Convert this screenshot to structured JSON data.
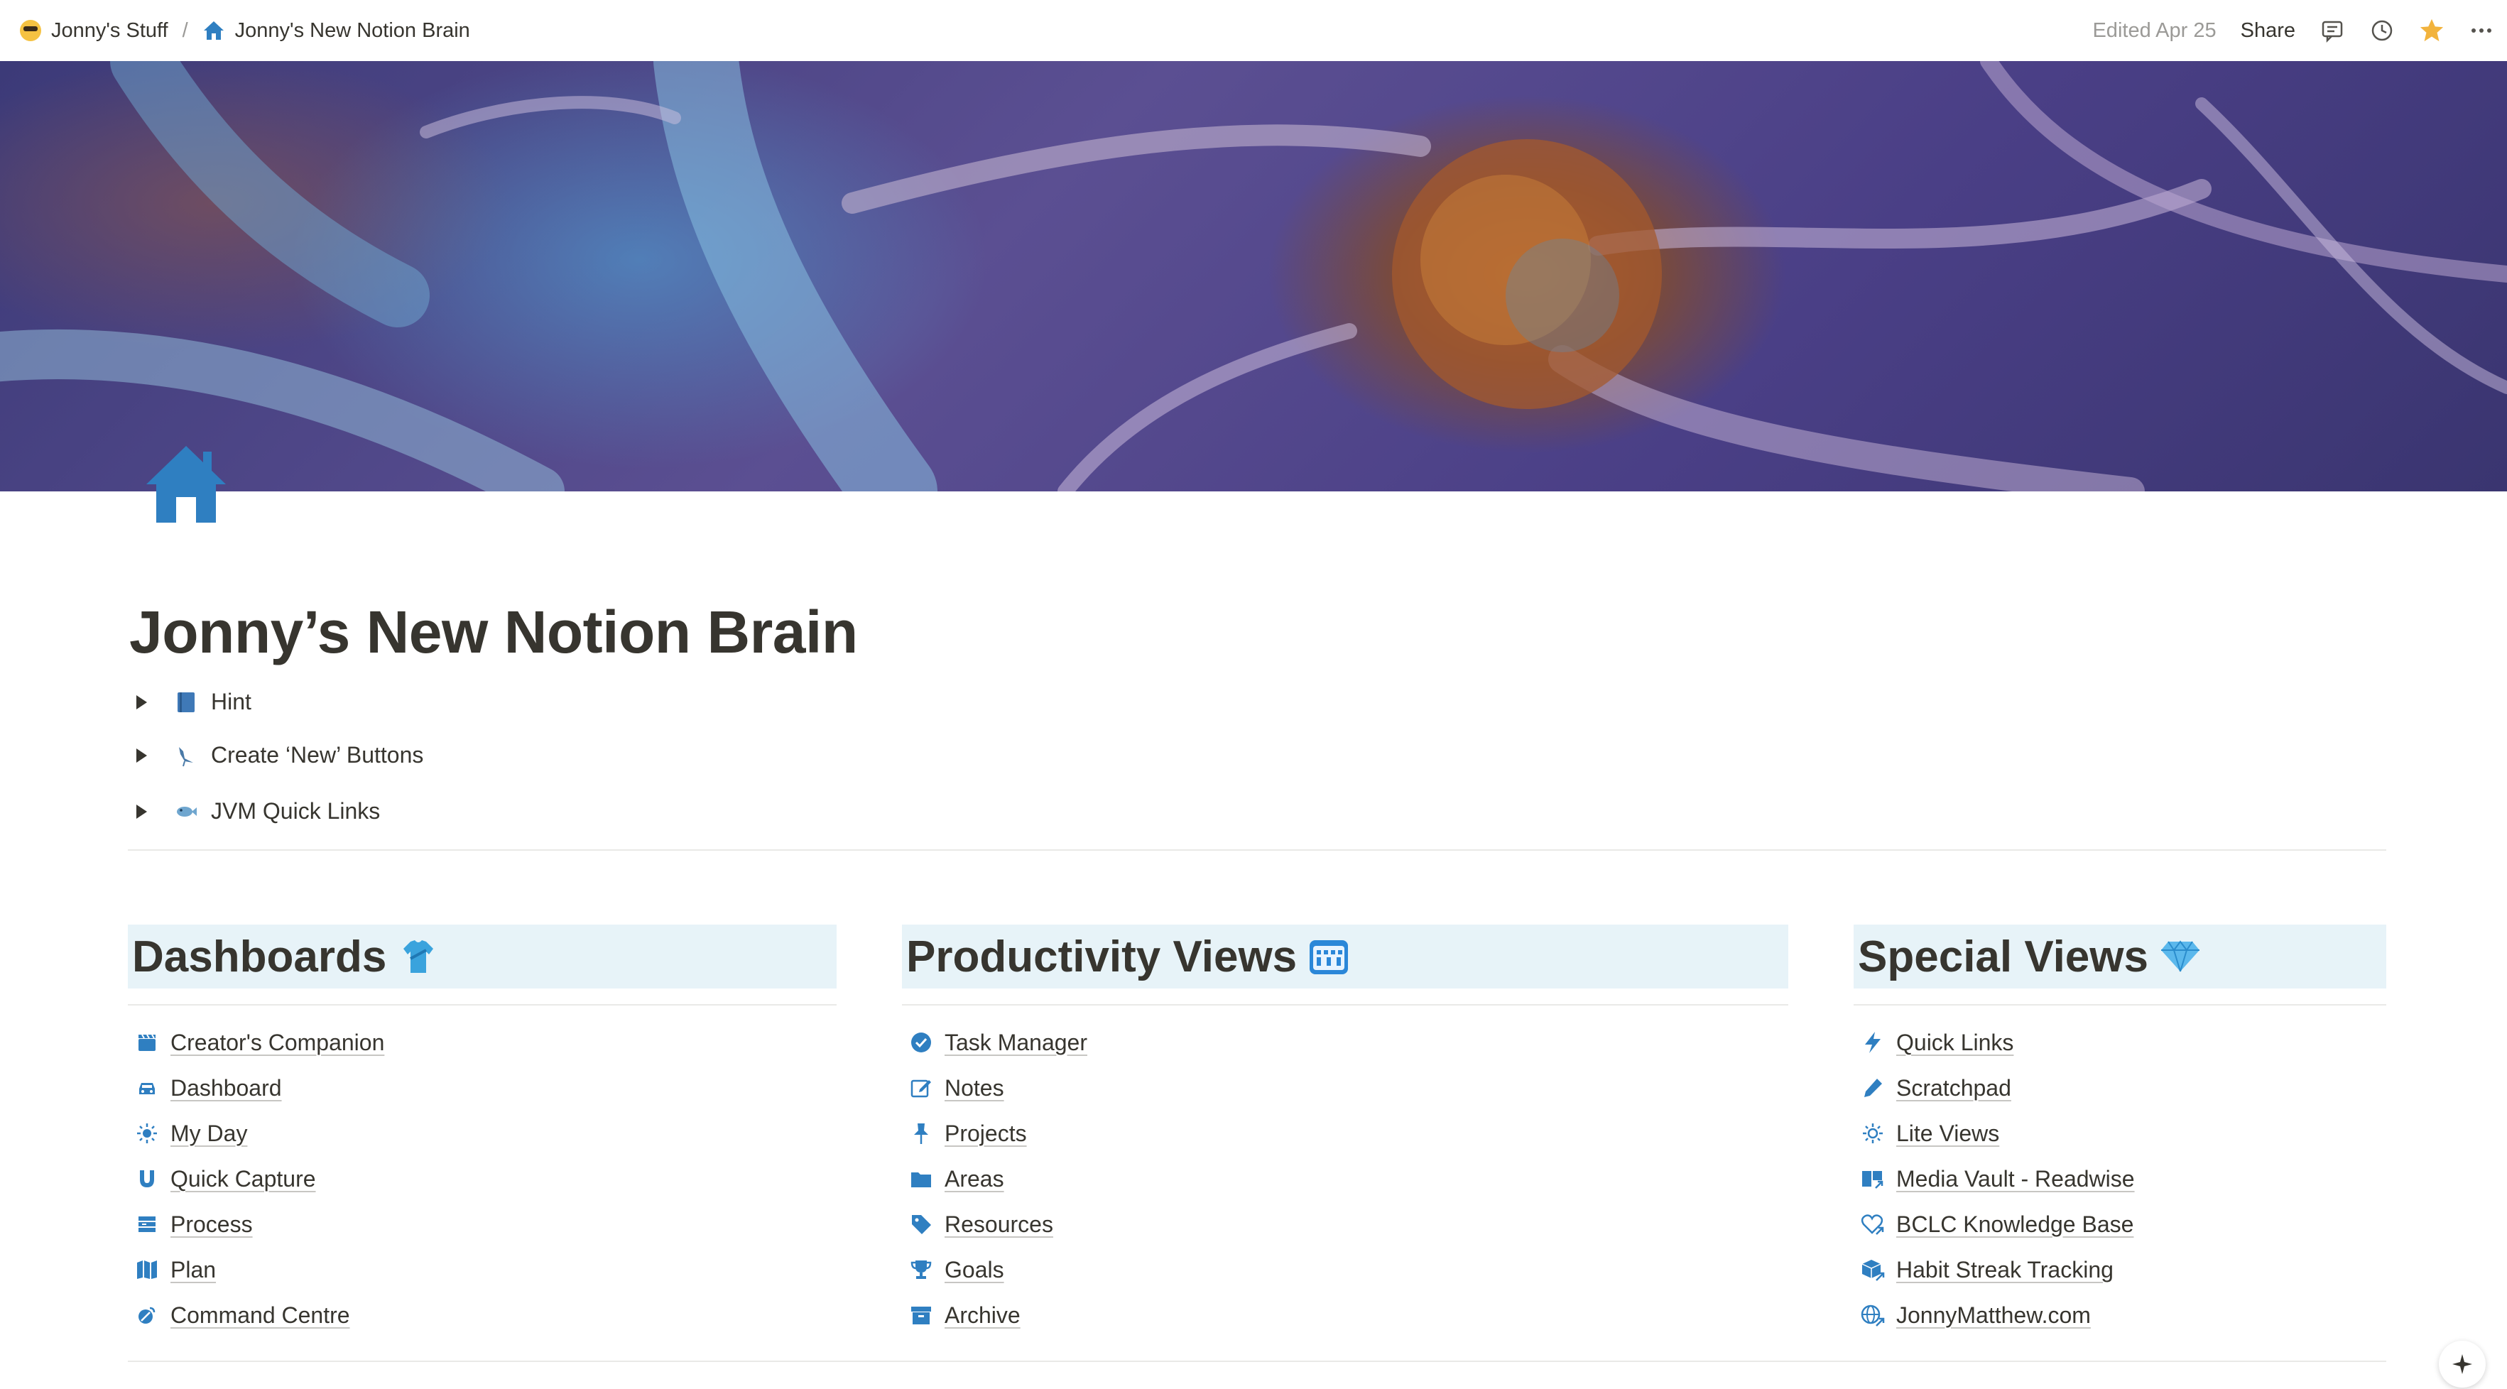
{
  "breadcrumb": {
    "workspace": "Jonny's Stuff",
    "separator": "/",
    "page": "Jonny's New Notion Brain"
  },
  "topbar": {
    "edited": "Edited Apr 25",
    "share": "Share",
    "icons": [
      "comment-icon",
      "history-icon",
      "star-icon",
      "more-icon"
    ]
  },
  "page": {
    "icon": "house-icon",
    "title": "Jonny’s New Notion Brain"
  },
  "toggles": [
    {
      "label": "Hint",
      "icon": "book-icon"
    },
    {
      "label": "Create ‘New’ Buttons",
      "icon": "heron-icon"
    },
    {
      "label": "JVM Quick Links",
      "icon": "fish-icon"
    }
  ],
  "columns": [
    {
      "title": "Dashboards",
      "emoji": "tshirt-icon",
      "items": [
        {
          "label": "Creator's Companion",
          "icon": "clapper-icon"
        },
        {
          "label": "Dashboard",
          "icon": "car-icon"
        },
        {
          "label": "My Day",
          "icon": "sun-icon"
        },
        {
          "label": "Quick Capture",
          "icon": "magnet-icon"
        },
        {
          "label": "Process",
          "icon": "process-icon"
        },
        {
          "label": "Plan",
          "icon": "map-icon"
        },
        {
          "label": "Command Centre",
          "icon": "satellite-icon"
        }
      ]
    },
    {
      "title": "Productivity Views",
      "emoji": "calendar-icon",
      "items": [
        {
          "label": "Task Manager",
          "icon": "checkmark-icon"
        },
        {
          "label": "Notes",
          "icon": "edit-icon"
        },
        {
          "label": "Projects",
          "icon": "pushpin-icon"
        },
        {
          "label": "Areas",
          "icon": "folder-icon"
        },
        {
          "label": "Resources",
          "icon": "tag-icon"
        },
        {
          "label": "Goals",
          "icon": "trophy-icon"
        },
        {
          "label": "Archive",
          "icon": "archive-icon"
        }
      ]
    },
    {
      "title": "Special Views",
      "emoji": "gem-icon",
      "items": [
        {
          "label": "Quick Links",
          "icon": "lightning-icon"
        },
        {
          "label": "Scratchpad",
          "icon": "pen-icon"
        },
        {
          "label": "Lite Views",
          "icon": "sun-outline-icon"
        },
        {
          "label": "Media Vault - Readwise",
          "icon": "book-link-icon"
        },
        {
          "label": "BCLC Knowledge Base",
          "icon": "heart-link-icon"
        },
        {
          "label": "Habit Streak Tracking",
          "icon": "cube-link-icon"
        },
        {
          "label": "JonnyMatthew.com",
          "icon": "globe-link-icon"
        }
      ]
    }
  ],
  "colors": {
    "accent": "#2f7fc1",
    "header_bg": "#e7f3f8",
    "text": "#37352f",
    "muted": "#9b9a97"
  }
}
